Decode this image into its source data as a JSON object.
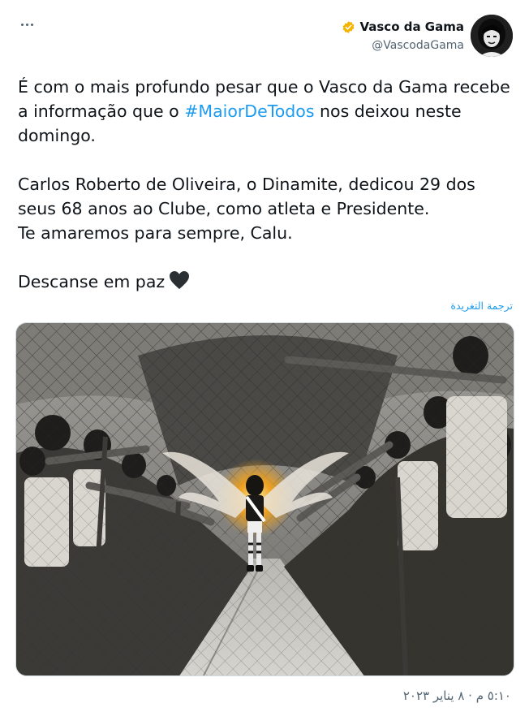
{
  "more_icon": "more-horizontal-icon",
  "author": {
    "name": "Vasco da Gama",
    "handle": "@VascodaGama",
    "verified_icon": "verified-badge-icon",
    "verified_color": "#f4b400"
  },
  "tweet": {
    "line1_before": "É com o mais profundo pesar que o Vasco da Gama recebe a informação que o ",
    "hashtag": "#MaiorDeTodos",
    "line1_after": " nos deixou neste domingo.",
    "paragraph2": "Carlos Roberto de Oliveira, o Dinamite, dedicou 29 dos seus 68 anos ao Clube, como atleta e Presidente.\nTe amaremos para sempre, Calu.",
    "paragraph3": "Descanse em paz",
    "emoji_icon": "black-heart-icon"
  },
  "translate_label": "ترجمة التغريدة",
  "media_icon": "tribute-photo-image",
  "timestamp": "٥:١٠ م · ٨ يناير ٢٠٢٣",
  "colors": {
    "link": "#1d9bf0",
    "text": "#0f1419",
    "secondary": "#536471"
  }
}
